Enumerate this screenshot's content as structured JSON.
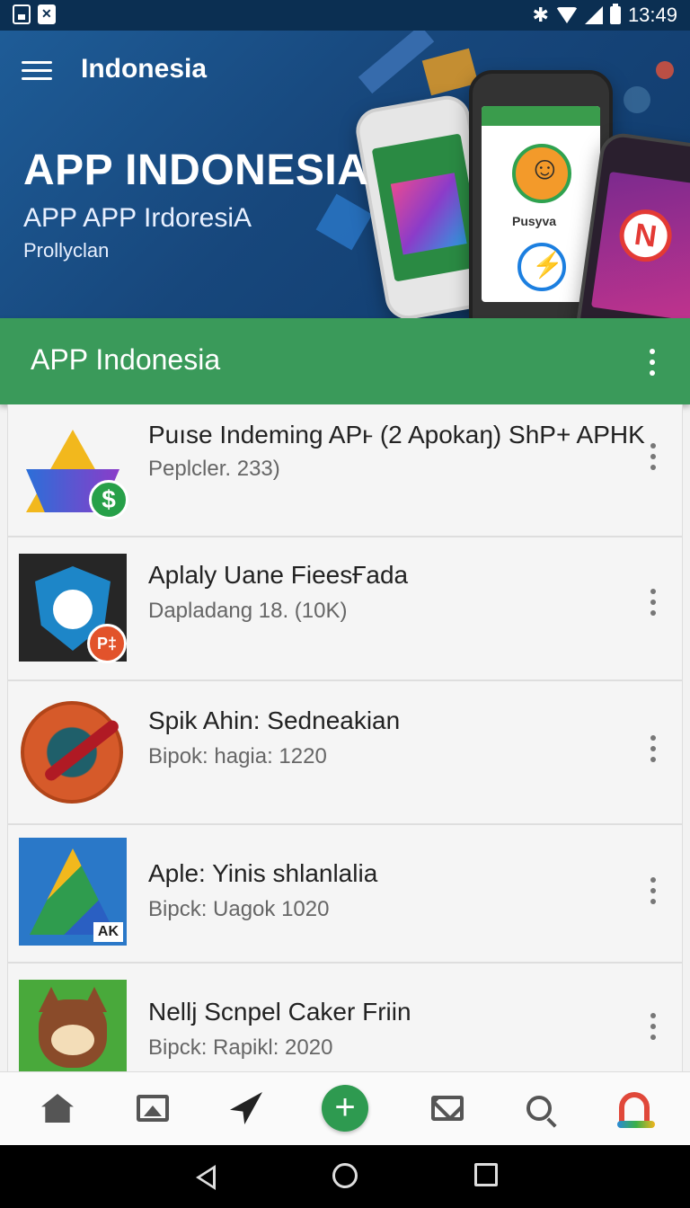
{
  "status_bar": {
    "time": "13:49",
    "icons": [
      "image-icon",
      "close-box-icon",
      "bluetooth-icon",
      "wifi-icon",
      "cell-signal-icon",
      "battery-icon"
    ]
  },
  "hero": {
    "header_title": "Indonesia",
    "title": "APP INDONESIA",
    "subtitle": "APP APP IrdoresiA",
    "tagline": "Prollyclan",
    "phone2_text": "Pusyva",
    "phone3_logo": "N"
  },
  "app_bar": {
    "title": "APP Indonesia"
  },
  "list": [
    {
      "title": "Puıse Indeming APⱶ (2 Apokaŋ) ShP+ APHK",
      "subtitle": "Peplcler. 233)",
      "badge": "$"
    },
    {
      "title": "Aplaly Uane FieesҒada",
      "subtitle": "Dapladang 18. (10K)",
      "badge": "P‡"
    },
    {
      "title": "Spik Ahin: Sedneakian",
      "subtitle": "Bipok: hagia: 1220"
    },
    {
      "title": "Aple: Yinis shlanlalia",
      "subtitle": "Bipck: Uagok 1020",
      "badge": "AK"
    },
    {
      "title": "Nellj Scnpel Caker Friin",
      "subtitle": "Bipck: Rapikl: 2020"
    }
  ],
  "bottom_nav": {
    "items": [
      "home-icon",
      "gallery-icon",
      "send-icon",
      "add-icon",
      "mail-icon",
      "search-icon",
      "magnet-icon"
    ],
    "add_label": "+"
  },
  "colors": {
    "status_bar": "#0b2f52",
    "hero": "#17477c",
    "app_bar": "#3a9a5a",
    "accent_green": "#2e9a50"
  }
}
